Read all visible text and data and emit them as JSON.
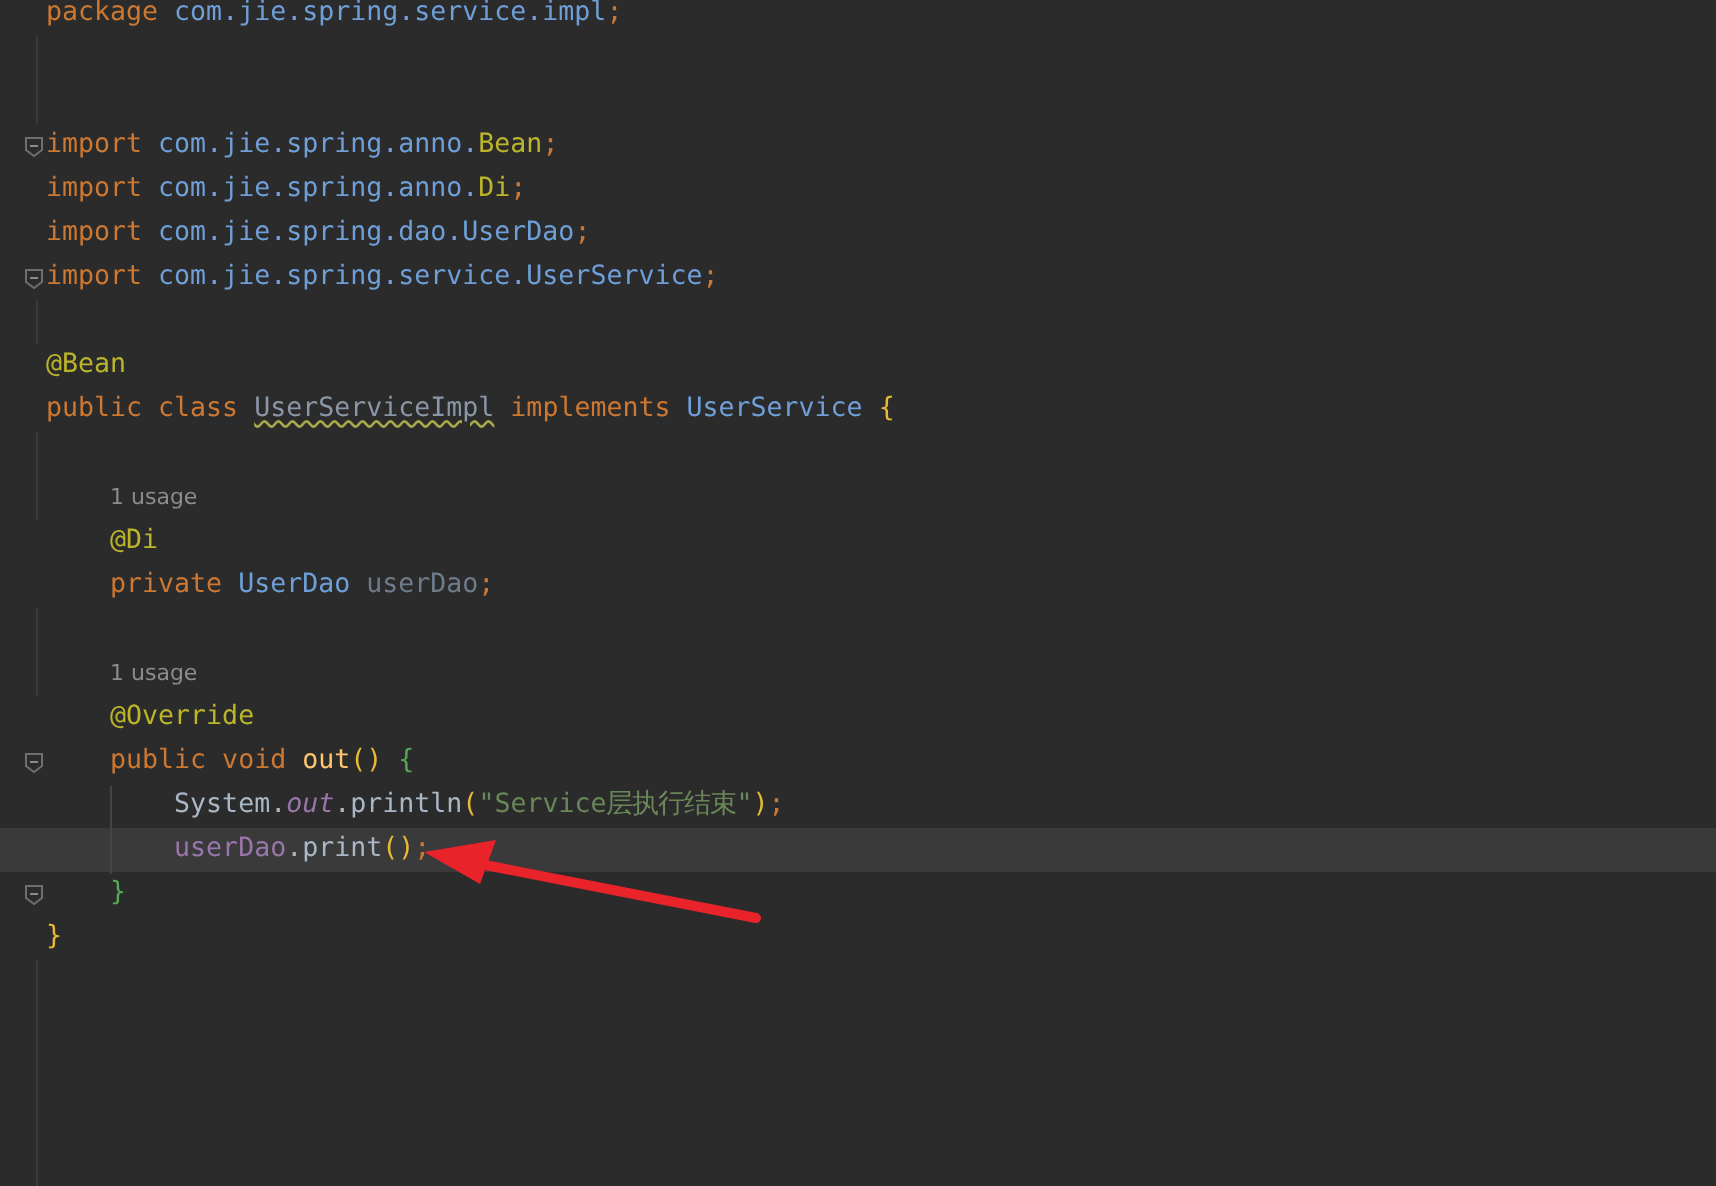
{
  "editor": {
    "lines": [
      {
        "kind": "code",
        "fold": false,
        "current": false,
        "tokens": [
          {
            "t": "package ",
            "kind": "kw"
          },
          {
            "t": "com.jie.spring.service.impl",
            "kind": "pkg"
          },
          {
            "t": ";",
            "kind": "kw"
          }
        ]
      },
      {
        "kind": "blank"
      },
      {
        "kind": "blank"
      },
      {
        "kind": "code",
        "fold": true,
        "current": false,
        "tokens": [
          {
            "t": "import ",
            "kind": "kw"
          },
          {
            "t": "com.jie.spring.anno.",
            "kind": "pkg"
          },
          {
            "t": "Bean",
            "kind": "ann"
          },
          {
            "t": ";",
            "kind": "kw"
          }
        ]
      },
      {
        "kind": "code",
        "fold": false,
        "current": false,
        "tokens": [
          {
            "t": "import ",
            "kind": "kw"
          },
          {
            "t": "com.jie.spring.anno.",
            "kind": "pkg"
          },
          {
            "t": "Di",
            "kind": "ann"
          },
          {
            "t": ";",
            "kind": "kw"
          }
        ]
      },
      {
        "kind": "code",
        "fold": false,
        "current": false,
        "tokens": [
          {
            "t": "import ",
            "kind": "kw"
          },
          {
            "t": "com.jie.spring.dao.UserDao",
            "kind": "pkg"
          },
          {
            "t": ";",
            "kind": "kw"
          }
        ]
      },
      {
        "kind": "code",
        "fold": true,
        "current": false,
        "tokens": [
          {
            "t": "import ",
            "kind": "kw"
          },
          {
            "t": "com.jie.spring.service.UserService",
            "kind": "pkg"
          },
          {
            "t": ";",
            "kind": "kw"
          }
        ]
      },
      {
        "kind": "blank"
      },
      {
        "kind": "code",
        "fold": false,
        "current": false,
        "tokens": [
          {
            "t": "@Bean",
            "kind": "ann"
          }
        ]
      },
      {
        "kind": "code",
        "fold": false,
        "current": false,
        "tokens": [
          {
            "t": "public class ",
            "kind": "kw"
          },
          {
            "t": "UserServiceImpl",
            "kind": "warn"
          },
          {
            "t": " implements ",
            "kind": "kw"
          },
          {
            "t": "UserService ",
            "kind": "cls"
          },
          {
            "t": "{",
            "kind": "br1"
          }
        ]
      },
      {
        "kind": "blank"
      },
      {
        "kind": "hint",
        "text": "1 usage"
      },
      {
        "kind": "code",
        "fold": false,
        "current": false,
        "tokens": [
          {
            "t": "    @Di",
            "kind": "ann"
          }
        ]
      },
      {
        "kind": "code",
        "fold": false,
        "current": false,
        "tokens": [
          {
            "t": "    private ",
            "kind": "kw"
          },
          {
            "t": "UserDao ",
            "kind": "cls"
          },
          {
            "t": "userDao",
            "kind": "unused"
          },
          {
            "t": ";",
            "kind": "kw"
          }
        ]
      },
      {
        "kind": "blank"
      },
      {
        "kind": "hint",
        "text": "1 usage"
      },
      {
        "kind": "code",
        "fold": false,
        "current": false,
        "tokens": [
          {
            "t": "    @Override",
            "kind": "ann"
          }
        ]
      },
      {
        "kind": "code",
        "fold": true,
        "current": false,
        "tokens": [
          {
            "t": "    public void ",
            "kind": "kw"
          },
          {
            "t": "out",
            "kind": "method"
          },
          {
            "t": "()",
            "kind": "br1"
          },
          {
            "t": " {",
            "kind": "br2"
          }
        ]
      },
      {
        "kind": "code",
        "fold": false,
        "current": false,
        "tokens": [
          {
            "t": "        System.",
            "kind": "plain"
          },
          {
            "t": "out",
            "kind": "static"
          },
          {
            "t": ".println",
            "kind": "plain"
          },
          {
            "t": "(",
            "kind": "br1"
          },
          {
            "t": "\"Service层执行结束\"",
            "kind": "str"
          },
          {
            "t": ")",
            "kind": "br1"
          },
          {
            "t": ";",
            "kind": "kw"
          }
        ]
      },
      {
        "kind": "code",
        "fold": false,
        "current": true,
        "tokens": [
          {
            "t": "        userDao",
            "kind": "field"
          },
          {
            "t": ".print",
            "kind": "plain"
          },
          {
            "t": "()",
            "kind": "br1"
          },
          {
            "t": ";",
            "kind": "kw"
          }
        ]
      },
      {
        "kind": "code",
        "fold": true,
        "current": false,
        "tokens": [
          {
            "t": "    }",
            "kind": "br2"
          }
        ]
      },
      {
        "kind": "code",
        "fold": false,
        "current": false,
        "tokens": [
          {
            "t": "}",
            "kind": "br1"
          }
        ]
      }
    ]
  },
  "annotation": {
    "kind": "arrow"
  }
}
